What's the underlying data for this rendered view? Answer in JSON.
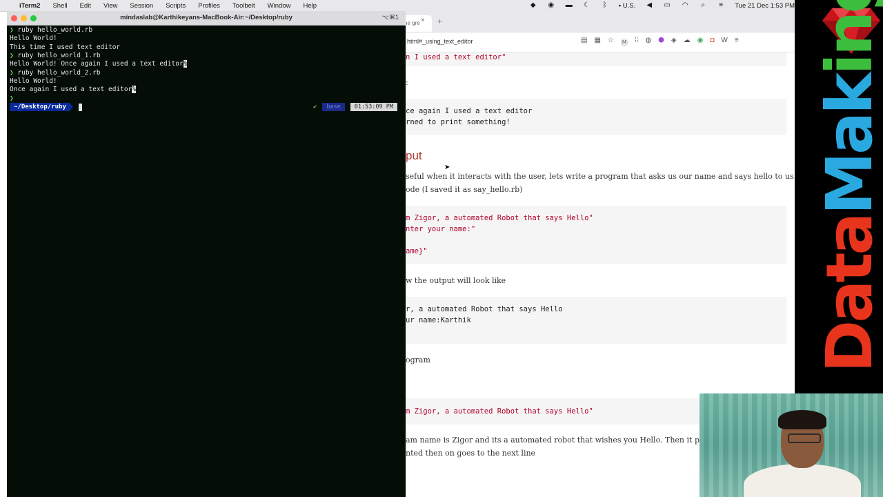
{
  "menubar": {
    "apple": "",
    "items": [
      "iTerm2",
      "Shell",
      "Edit",
      "View",
      "Session",
      "Scripts",
      "Profiles",
      "Toolbelt",
      "Window",
      "Help"
    ],
    "input_source": "U.S.",
    "datetime": "Tue 21 Dec  1:53 PM"
  },
  "terminal": {
    "title": "mindaslab@Karthikeyans-MacBook-Air:~/Desktop/ruby",
    "shortcut": "⌥⌘1",
    "lines": [
      {
        "prompt": "❯ ",
        "text": "ruby hello_world.rb"
      },
      {
        "prompt": "",
        "text": "Hello World!"
      },
      {
        "prompt": "",
        "text": "This time I used text editor"
      },
      {
        "prompt": "❯ ",
        "text": "ruby hello_world_1.rb"
      },
      {
        "prompt": "",
        "text": "Hello World! Once again I used a text editor"
      },
      {
        "prompt": "❯ ",
        "text": "ruby hello_world_2.rb"
      },
      {
        "prompt": "",
        "text": "Hello World!"
      },
      {
        "prompt": "",
        "text": "Once again I used a text editor"
      },
      {
        "prompt": "❯",
        "text": ""
      }
    ],
    "ps1": "~/Desktop/ruby",
    "rprompt_check": "✔",
    "rprompt_env": "base",
    "rprompt_time": "01:53:09 PM"
  },
  "browser": {
    "tab_label": "he gre",
    "url": "html#_using_text_editor",
    "code1": "n I used a text editor\"",
    "prose_colon": ":",
    "code2_line1": "ce again I used a text editor",
    "code2_line2": "rned to print something!",
    "heading": "put",
    "prose1_line1": "seful when it interacts with the user, lets write a program that asks us our name and says hello to us.",
    "prose1_line2": "ode (I saved it as say_hello.rb)",
    "code3_line1": "m Zigor, a automated Robot that says Hello\"",
    "code3_line2": "nter your name:\"",
    "code3_line3_a": "ame",
    "code3_line3_b": "}\"",
    "prose2": "w the output will look like",
    "code4_line1": "r, a automated Robot that says Hello",
    "code4_line2": "ur name:Karthik",
    "prose3": "ogram",
    "code5": "m Zigor, a automated Robot that says Hello\"",
    "prose4_line1": "am name is Zigor and its a automated robot that wishes you Hello. Then it prin",
    "prose4_line2": "nted then on goes to the next line"
  },
  "banner": {
    "brand_part1": "Data",
    "brand_part2": "Mak",
    "brand_part3": "ing"
  },
  "colors": {
    "terminal_bg": "#050d07",
    "ps1_bg": "#0a2a9a",
    "code_string": "#b00028",
    "heading": "#b0382a",
    "brand_red": "#e8341c",
    "brand_blue": "#2aa9e0",
    "brand_green": "#3dbd3d"
  }
}
